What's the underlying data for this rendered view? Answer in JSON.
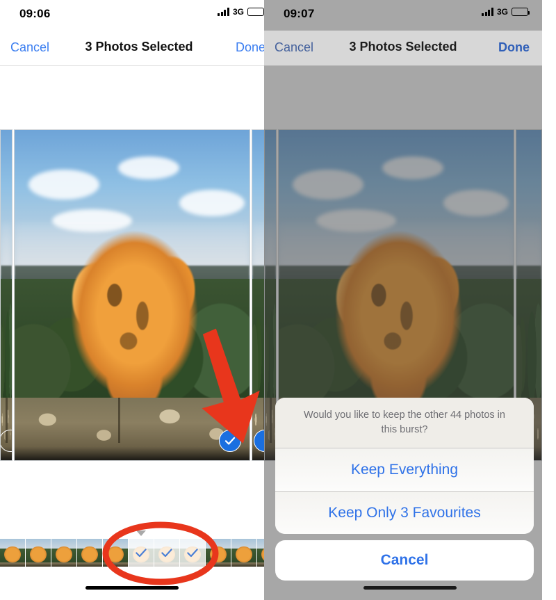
{
  "left_panel": {
    "status": {
      "time": "09:06",
      "network": "3G",
      "signal_icon": "signal-bars-icon",
      "battery_icon": "battery-icon"
    },
    "nav": {
      "cancel_label": "Cancel",
      "title": "3 Photos Selected",
      "done_label": "Done"
    },
    "photo": {
      "scene": "autumn-tree-over-stone-wall",
      "selected_badge_icon": "checkmark-circle-icon"
    },
    "filmstrip": {
      "total_thumbs": 11,
      "selected_indices": [
        4,
        5,
        6
      ],
      "pointer_icon": "triangle-down-icon",
      "tick_icon": "checkmark-icon"
    },
    "annotations": {
      "arrow": {
        "icon": "red-arrow-icon",
        "color": "#e8361c"
      },
      "oval": {
        "icon": "red-oval-icon",
        "color": "#e8361c"
      }
    },
    "home_indicator": "home-indicator"
  },
  "right_panel": {
    "status": {
      "time": "09:07",
      "network": "3G",
      "signal_icon": "signal-bars-icon",
      "battery_icon": "battery-icon"
    },
    "nav": {
      "cancel_label": "Cancel",
      "title": "3 Photos Selected",
      "done_label": "Done"
    },
    "dimmed": true,
    "action_sheet": {
      "message": "Would you like to keep the other 44 photos in this burst?",
      "options": [
        {
          "label": "Keep Everything"
        },
        {
          "label": "Keep Only 3 Favourites"
        }
      ],
      "cancel_label": "Cancel"
    },
    "home_indicator": "home-indicator"
  },
  "colors": {
    "accent_blue": "#2f72e8",
    "nav_blue": "#3b7ef0",
    "annotation_red": "#e8361c",
    "badge_blue": "#1a6fe0",
    "sheet_text_gray": "#6d6d72"
  }
}
